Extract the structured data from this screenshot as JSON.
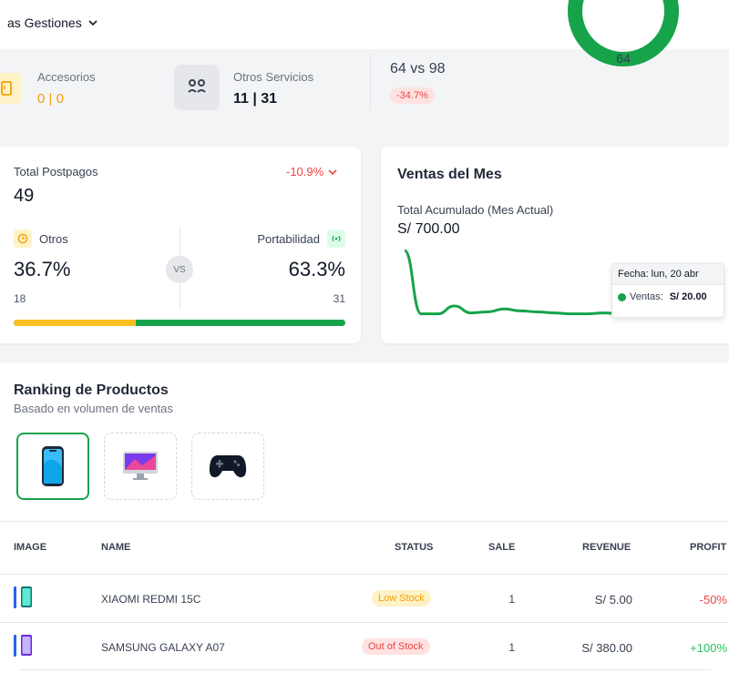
{
  "header": {
    "title": "as Gestiones"
  },
  "summary": {
    "accesorios": {
      "label": "Accesorios",
      "value": "0 | 0"
    },
    "otros_servicios": {
      "label": "Otros Servicios",
      "value": "11 | 31"
    },
    "comparison": {
      "value": "64 vs 98",
      "delta": "-34.7%"
    },
    "donut": {
      "value": "64"
    }
  },
  "postpagos": {
    "title": "Total Postpagos",
    "total": "49",
    "change": "-10.9%",
    "left": {
      "label": "Otros",
      "percent": "36.7%",
      "count": "18"
    },
    "vs": "VS",
    "right": {
      "label": "Portabilidad",
      "percent": "63.3%",
      "count": "31"
    },
    "split_left_fraction": 0.367
  },
  "ventas": {
    "title": "Ventas del Mes",
    "subtitle": "Total Acumulado (Mes Actual)",
    "total": "S/ 700.00",
    "tooltip": {
      "date": "Fecha: lun, 20 abr",
      "label": "Ventas:",
      "value": "S/ 20.00"
    }
  },
  "chart_data": {
    "type": "line",
    "series": [
      {
        "values": [
          340,
          20,
          20,
          60,
          25,
          30,
          45,
          35,
          30,
          25,
          20,
          20,
          25,
          20,
          30,
          20,
          30,
          20,
          20,
          20
        ]
      }
    ],
    "color": "#16a34a",
    "grid": false,
    "ylim": [
      0,
      350
    ]
  },
  "ranking": {
    "title": "Ranking de Productos",
    "subtitle": "Basado en volumen de ventas",
    "categories": [
      {
        "icon": "smartphone-icon",
        "active": true
      },
      {
        "icon": "monitor-icon",
        "active": false
      },
      {
        "icon": "gamepad-icon",
        "active": false
      }
    ]
  },
  "table": {
    "headers": {
      "image": "IMAGE",
      "name": "NAME",
      "status": "STATUS",
      "sale": "SALE",
      "revenue": "REVENUE",
      "profit": "PROFIT"
    },
    "rows": [
      {
        "name": "XIAOMI REDMI 15C",
        "status": "Low Stock",
        "sale": "1",
        "revenue": "S/ 5.00",
        "profit": "-50%"
      },
      {
        "name": "SAMSUNG GALAXY A07",
        "status": "Out of Stock",
        "sale": "1",
        "revenue": "S/ 380.00",
        "profit": "+100%"
      }
    ]
  },
  "colors": {
    "accent_green": "#16a34a",
    "accent_orange": "#fbbf24",
    "negative": "#ef4444",
    "positive": "#22c55e"
  }
}
